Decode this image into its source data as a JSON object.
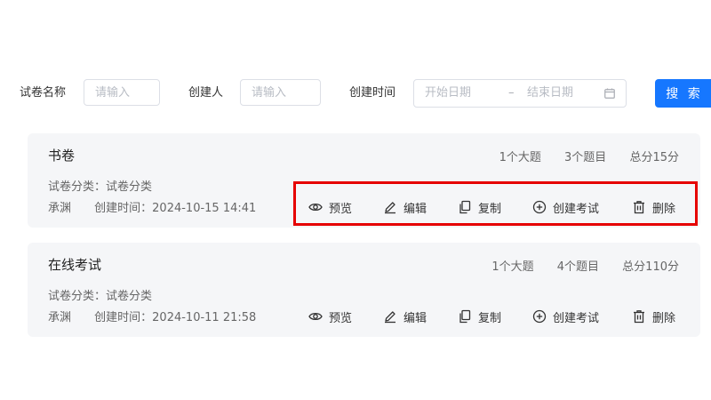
{
  "search": {
    "name_label": "试卷名称",
    "name_placeholder": "请输入",
    "creator_label": "创建人",
    "creator_placeholder": "请输入",
    "time_label": "创建时间",
    "start_placeholder": "开始日期",
    "range_separator": "–",
    "end_placeholder": "结束日期",
    "search_button": "搜 索"
  },
  "papers": [
    {
      "title": "书卷",
      "sections": "1个大题",
      "questions": "3个题目",
      "score": "总分15分",
      "category": "试卷分类：试卷分类",
      "creator": "承渊",
      "created": "创建时间：2024-10-15 14:41"
    },
    {
      "title": "在线考试",
      "sections": "1个大题",
      "questions": "4个题目",
      "score": "总分110分",
      "category": "试卷分类：试卷分类",
      "creator": "承渊",
      "created": "创建时间：2024-10-11 21:58"
    }
  ],
  "actions": {
    "preview": "预览",
    "edit": "编辑",
    "copy": "复制",
    "create_exam": "创建考试",
    "delete": "删除"
  },
  "icons": {
    "preview": "eye-icon",
    "edit": "pencil-icon",
    "copy": "copy-icon",
    "create_exam": "plus-circle-icon",
    "delete": "trash-icon",
    "calendar": "calendar-icon"
  },
  "colors": {
    "primary": "#1677ff",
    "highlight": "#e60000",
    "card_bg": "#f5f6f8"
  }
}
